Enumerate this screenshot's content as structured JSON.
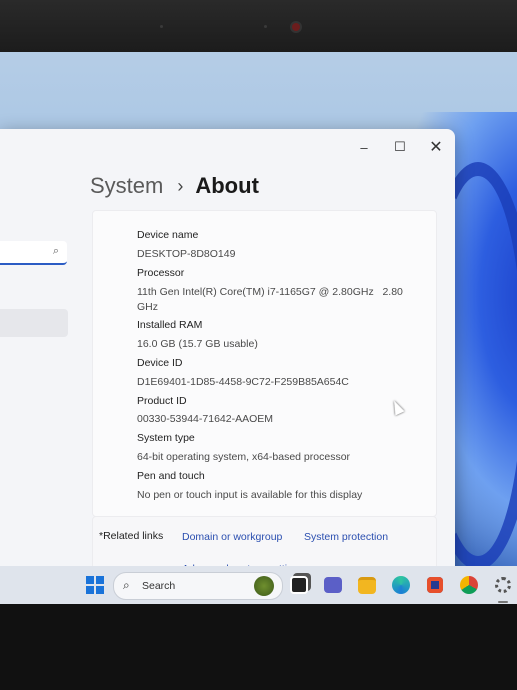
{
  "window": {
    "controls": {
      "minimize": "–",
      "maximize": "☐",
      "close": "✕"
    }
  },
  "breadcrumb": {
    "parent": "System",
    "separator": "›",
    "current": "About"
  },
  "sidebar": {
    "search_icon": "⌕"
  },
  "specs": [
    {
      "label": "Device name",
      "value": "DESKTOP-8D8O149"
    },
    {
      "label": "Processor",
      "value": "11th Gen Intel(R) Core(TM) i7-1165G7 @ 2.80GHz   2.80",
      "value2": "GHz"
    },
    {
      "label": "Installed RAM",
      "value": "16.0 GB (15.7 GB usable)"
    },
    {
      "label": "Device ID",
      "value": "D1E69401-1D85-4458-9C72-F259B85A654C"
    },
    {
      "label": "Product ID",
      "value": "00330-53944-71642-AAOEM"
    },
    {
      "label": "System type",
      "value": "64-bit operating system, x64-based processor"
    },
    {
      "label": "Pen and touch",
      "value": "No pen or touch input is available for this display"
    }
  ],
  "related_links": {
    "label": "*Related links",
    "links": [
      "Domain or workgroup",
      "System protection",
      "Advanced system settings"
    ]
  },
  "taskbar": {
    "search_label": "Search",
    "search_icon": "⌕"
  },
  "colors": {
    "accent": "#2b5cc4",
    "link": "#2b4fb0",
    "window_bg": "#f4f5f8",
    "taskbar_bg": "#dfe4ec"
  }
}
